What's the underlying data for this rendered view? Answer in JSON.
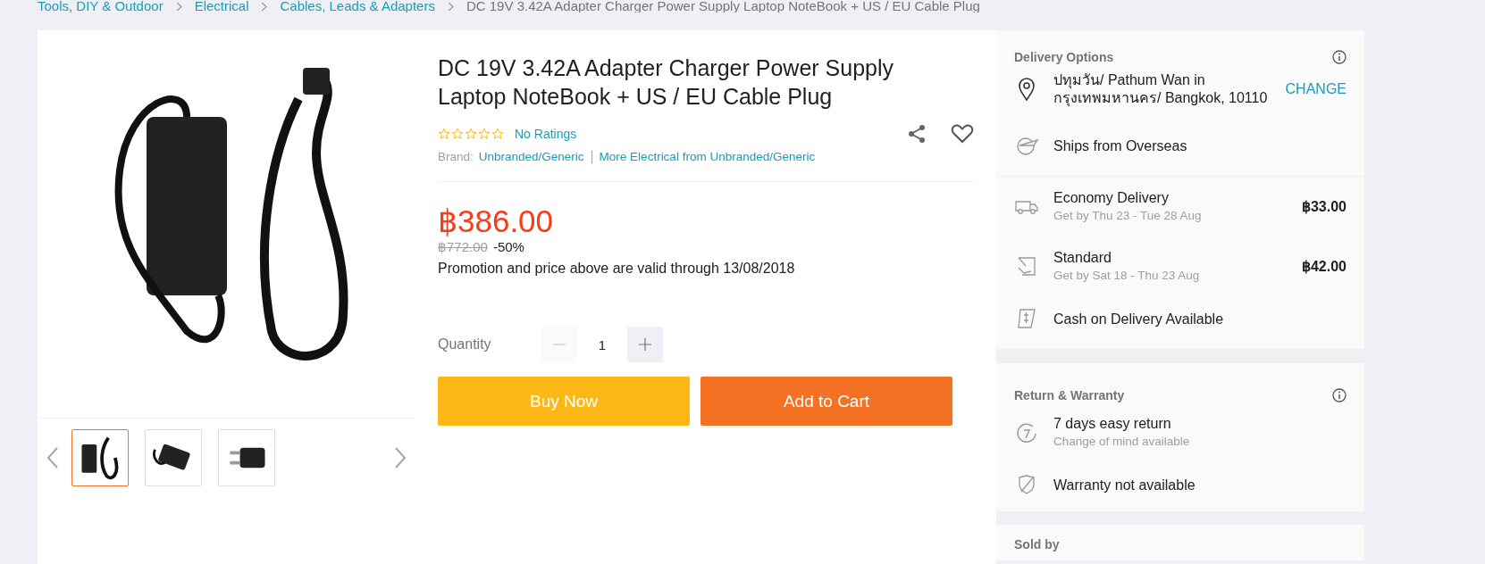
{
  "breadcrumb": [
    {
      "label": "Tools, DIY & Outdoor",
      "link": true
    },
    {
      "label": "Electrical",
      "link": true
    },
    {
      "label": "Cables, Leads & Adapters",
      "link": true
    },
    {
      "label": "DC 19V 3.42A Adapter Charger Power Supply Laptop NoteBook + US / EU Cable Plug",
      "link": false
    }
  ],
  "gallery": {
    "thumbnails": [
      {
        "selected": true
      },
      {
        "selected": false
      },
      {
        "selected": false
      }
    ]
  },
  "product": {
    "title": "DC 19V 3.42A Adapter Charger Power Supply Laptop NoteBook + US / EU Cable Plug",
    "stars": 0,
    "ratings": "No Ratings",
    "brand_label": "Brand:",
    "brand": "Unbranded/Generic",
    "more_link": "More Electrical from Unbranded/Generic",
    "price": "฿386.00",
    "old_price": "฿772.00",
    "discount": "-50%",
    "promotion": "Promotion and price above are valid through 13/08/2018",
    "quantity_label": "Quantity",
    "quantity": "1",
    "decrement_disabled": true,
    "buttons": [
      {
        "label": "Buy Now",
        "kind": "buy"
      },
      {
        "label": "Add to Cart",
        "kind": "cart"
      }
    ]
  },
  "delivery": {
    "title": "Delivery Options",
    "address": "ปทุมวัน/ Pathum Wan in กรุงเทพมหานคร/ Bangkok, 10110",
    "change": "CHANGE",
    "rows": [
      {
        "kind": "plane",
        "label": "Ships from Overseas",
        "section_end": true
      },
      {
        "kind": "truck",
        "label": "Economy Delivery",
        "sub": "Get by Thu 23 - Tue 28 Aug",
        "price": "฿33.00"
      },
      {
        "kind": "hand",
        "label": "Standard",
        "sub": "Get by Sat 18 - Thu 23 Aug",
        "price": "฿42.00"
      },
      {
        "kind": "cash",
        "label": "Cash on Delivery Available",
        "section_end": true
      }
    ]
  },
  "returns": {
    "title": "Return & Warranty",
    "rows": [
      {
        "kind": "return",
        "label": "7 days easy return",
        "sub": "Change of mind available"
      },
      {
        "kind": "shield",
        "label": "Warranty not available"
      }
    ]
  },
  "seller": {
    "title": "Sold by"
  }
}
